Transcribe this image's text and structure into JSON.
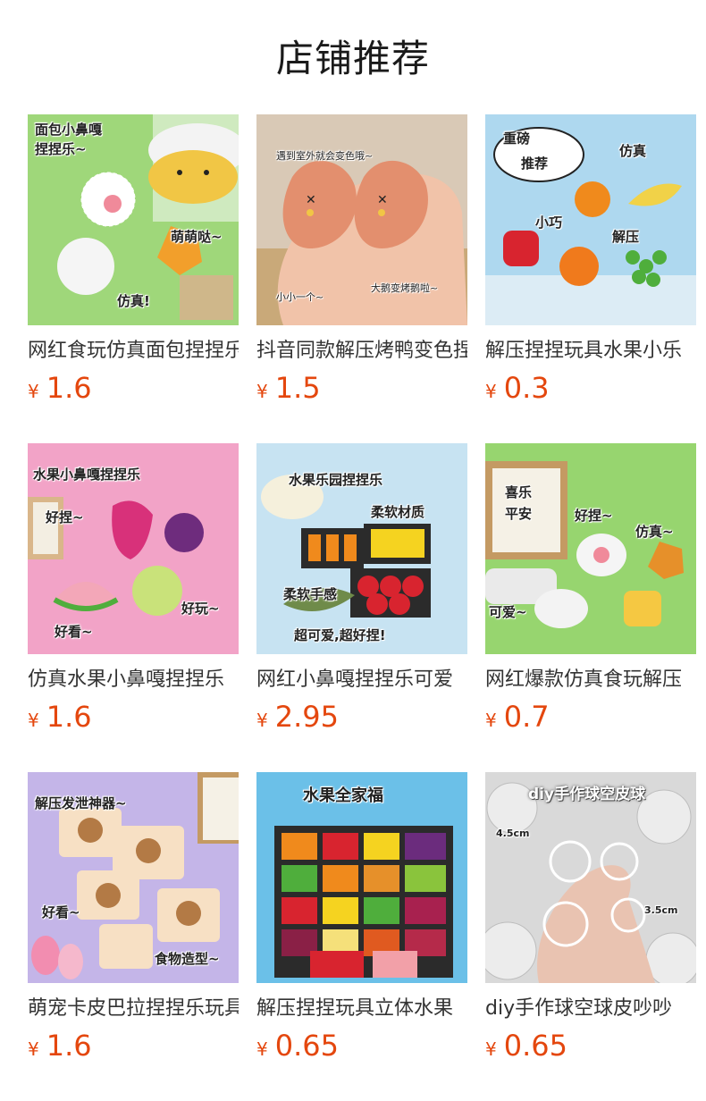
{
  "section": {
    "title": "店铺推荐"
  },
  "colors": {
    "price": "#e4470e",
    "title": "#1a1a1a",
    "name": "#333333"
  },
  "products": [
    {
      "name": "网红食玩仿真面包捏捏乐",
      "currency": "¥",
      "price": "1.6",
      "image": {
        "icon": "bread-squishy-image",
        "captions": [
          "面包小鼻嘎",
          "捏捏乐~",
          "萌萌哒~",
          "仿真!"
        ]
      }
    },
    {
      "name": "抖音同款解压烤鸭变色捏捏乐",
      "currency": "¥",
      "price": "1.5",
      "image": {
        "icon": "roast-duck-squishy-image",
        "captions": [
          "遇到室外就会变色哦~",
          "小小一个~",
          "大鹅变烤鹅啦~"
        ]
      }
    },
    {
      "name": "解压捏捏玩具水果小乐",
      "currency": "¥",
      "price": "0.3",
      "image": {
        "icon": "fruit-squishy-image",
        "captions": [
          "重磅",
          "推荐",
          "仿真",
          "小巧",
          "解压"
        ]
      }
    },
    {
      "name": "仿真水果小鼻嘎捏捏乐",
      "currency": "¥",
      "price": "1.6",
      "image": {
        "icon": "fruit-nose-squishy-image",
        "captions": [
          "水果小鼻嘎捏捏乐",
          "好捏~",
          "好看~",
          "好玩~"
        ]
      }
    },
    {
      "name": "网红小鼻嘎捏捏乐可爱",
      "currency": "¥",
      "price": "2.95",
      "image": {
        "icon": "fruit-garden-squishy-image",
        "captions": [
          "水果乐园捏捏乐",
          "柔软材质",
          "柔软手感",
          "超可爱,超好捏!"
        ]
      }
    },
    {
      "name": "网红爆款仿真食玩解压",
      "currency": "¥",
      "price": "0.7",
      "image": {
        "icon": "food-squishy-image",
        "captions": [
          "喜乐",
          "平安",
          "好捏~",
          "仿真~",
          "可爱~"
        ]
      }
    },
    {
      "name": "萌宠卡皮巴拉捏捏乐玩具",
      "currency": "¥",
      "price": "1.6",
      "image": {
        "icon": "capybara-squishy-image",
        "captions": [
          "解压发泄神器~",
          "好看~",
          "食物造型~"
        ]
      }
    },
    {
      "name": "解压捏捏玩具立体水果",
      "currency": "¥",
      "price": "0.65",
      "image": {
        "icon": "fruit-family-squishy-image",
        "captions": [
          "水果全家福"
        ]
      }
    },
    {
      "name": "diy手作球空球皮吵吵",
      "currency": "¥",
      "price": "0.65",
      "image": {
        "icon": "clear-ball-image",
        "captions": [
          "diy手作球空皮球",
          "4.5cm",
          "3.5cm"
        ]
      }
    }
  ]
}
